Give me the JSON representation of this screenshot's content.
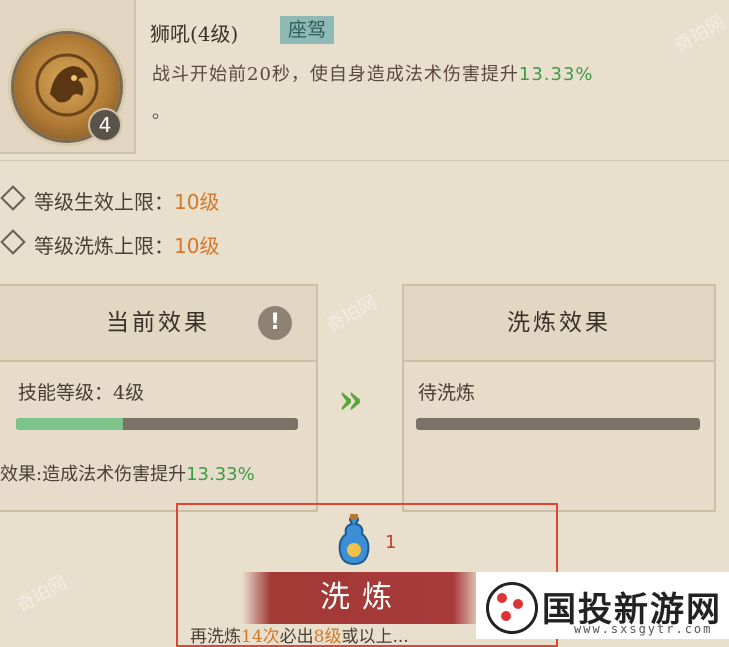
{
  "skill": {
    "title": "狮吼(4级)",
    "tag": "座驾",
    "level_badge": "4",
    "desc_main": "战斗开始前20秒，使自身造成法术伤害提升",
    "desc_value": "13.33%",
    "desc_end": "。"
  },
  "limits": [
    {
      "label": "等级生效上限：",
      "value": "10级"
    },
    {
      "label": "等级洗炼上限：",
      "value": "10级"
    }
  ],
  "current_panel": {
    "title": "当前效果",
    "level_text": "技能等级：4级",
    "progress": 0.38,
    "effect_label": "效果:造成法术伤害提升",
    "effect_value": "13.33%"
  },
  "refine_panel": {
    "title": "洗炼效果",
    "status_text": "待洗炼",
    "progress": 0
  },
  "arrow": "»",
  "refine": {
    "item_count": "1",
    "button_label": "洗炼",
    "hint_prefix": "再洗炼",
    "hint_count": "14次",
    "hint_mid": "必出",
    "hint_level": "8级",
    "hint_suffix": "或以上..."
  },
  "watermark": {
    "title": "国投新游网",
    "url": "www.sxsgytr.com",
    "faint": "奇珀网"
  },
  "colors": {
    "accent_green": "#3d9a45",
    "accent_orange": "#d2782b",
    "button_red": "#a83a3a",
    "highlight_border": "#e0453a"
  }
}
